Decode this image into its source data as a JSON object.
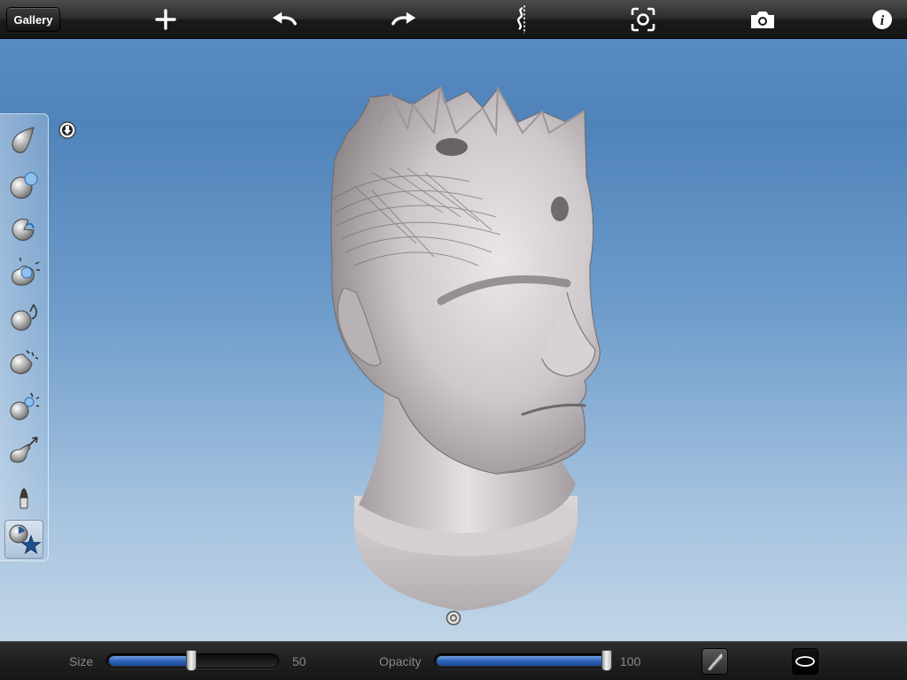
{
  "toolbar": {
    "gallery_label": "Gallery",
    "icons": [
      "add-icon",
      "undo-icon",
      "redo-icon",
      "symmetry-icon",
      "focus-icon",
      "camera-icon",
      "info-icon"
    ]
  },
  "palette": {
    "tools": [
      {
        "name": "draw-tool-icon"
      },
      {
        "name": "inflate-tool-icon"
      },
      {
        "name": "pinch-tool-icon"
      },
      {
        "name": "smooth-tool-icon"
      },
      {
        "name": "grab-tool-icon"
      },
      {
        "name": "flatten-tool-icon"
      },
      {
        "name": "crease-tool-icon"
      },
      {
        "name": "move-tool-icon"
      },
      {
        "name": "paint-tool-icon"
      },
      {
        "name": "stamp-tool-icon",
        "active": true
      }
    ]
  },
  "bottombar": {
    "size_label": "Size",
    "size_value": "50",
    "size_level": 0.49,
    "opacity_label": "Opacity",
    "opacity_value": "100",
    "opacity_level": 1.0
  },
  "colors": {
    "toolbar_bg": "#1b1b1b",
    "viewport_top": "#4f83ba",
    "viewport_bottom": "#c9daea",
    "slider_fill": "#2f63b8"
  }
}
